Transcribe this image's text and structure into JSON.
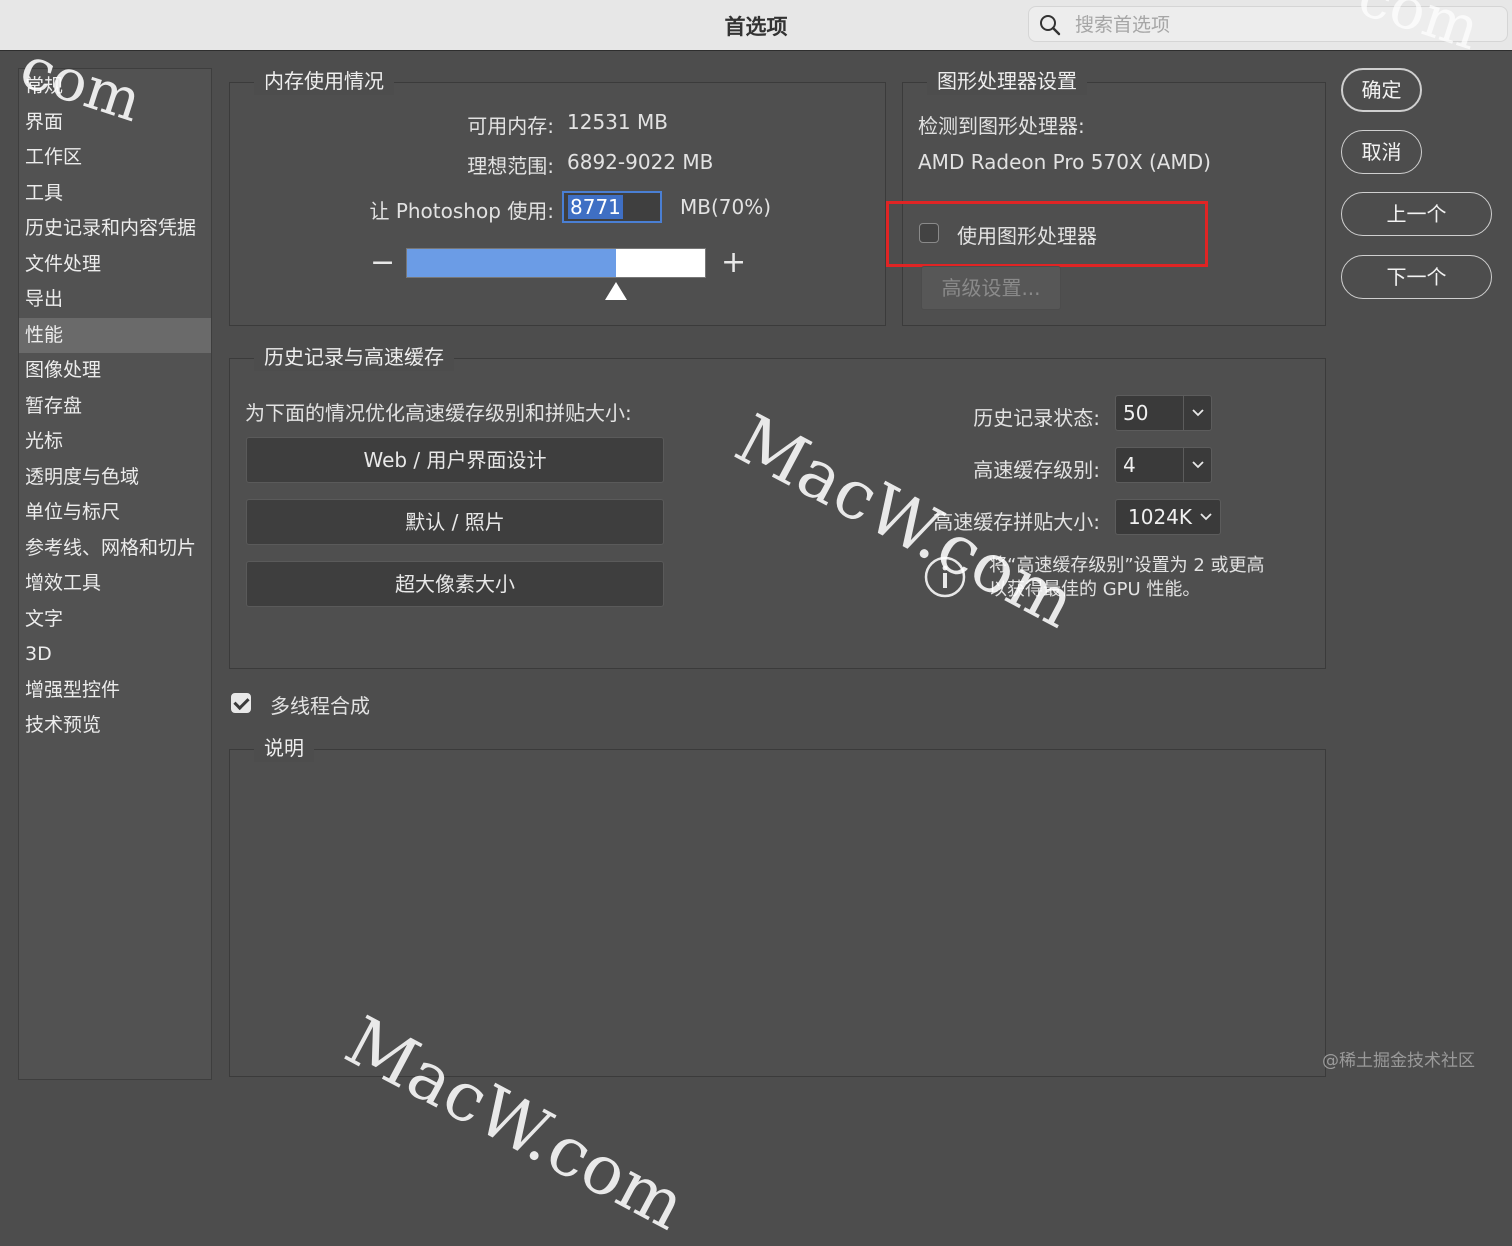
{
  "window": {
    "title": "首选项",
    "search_placeholder": "搜索首选项"
  },
  "sidebar": {
    "items": [
      {
        "label": "常规"
      },
      {
        "label": "界面"
      },
      {
        "label": "工作区"
      },
      {
        "label": "工具"
      },
      {
        "label": "历史记录和内容凭据"
      },
      {
        "label": "文件处理"
      },
      {
        "label": "导出"
      },
      {
        "label": "性能",
        "active": true
      },
      {
        "label": "图像处理"
      },
      {
        "label": "暂存盘"
      },
      {
        "label": "光标"
      },
      {
        "label": "透明度与色域"
      },
      {
        "label": "单位与标尺"
      },
      {
        "label": "参考线、网格和切片"
      },
      {
        "label": "增效工具"
      },
      {
        "label": "文字"
      },
      {
        "label": "3D"
      },
      {
        "label": "增强型控件"
      },
      {
        "label": "技术预览"
      }
    ]
  },
  "memory": {
    "title": "内存使用情况",
    "available_label": "可用内存:",
    "available_value": "12531 MB",
    "ideal_label": "理想范围:",
    "ideal_value": "6892-9022 MB",
    "use_label": "让 Photoshop 使用:",
    "use_value": "8771",
    "use_unit": "MB(70%)",
    "slider_fraction": 0.7,
    "minus": "−",
    "plus": "+"
  },
  "gpu": {
    "title": "图形处理器设置",
    "detected_label": "检测到图形处理器:",
    "detected_value": "AMD Radeon Pro 570X (AMD)",
    "use_gpu_label": "使用图形处理器",
    "use_gpu_checked": false,
    "advanced_label": "高级设置..."
  },
  "history_cache": {
    "title": "历史记录与高速缓存",
    "optimize_label": "为下面的情况优化高速缓存级别和拼贴大小:",
    "presets": [
      "Web / 用户界面设计",
      "默认 / 照片",
      "超大像素大小"
    ],
    "history_states_label": "历史记录状态:",
    "history_states_value": "50",
    "cache_levels_label": "高速缓存级别:",
    "cache_levels_value": "4",
    "tile_size_label": "高速缓存拼贴大小:",
    "tile_size_value": "1024K",
    "tip_line1": "将“高速缓存级别”设置为 2 或更高",
    "tip_line2": "以获得最佳的 GPU 性能。"
  },
  "multithread": {
    "label": "多线程合成",
    "checked": true
  },
  "description": {
    "title": "说明"
  },
  "buttons": {
    "ok": "确定",
    "cancel": "取消",
    "prev": "上一个",
    "next": "下一个"
  },
  "overlays": {
    "watermark_main": "MacW.com",
    "watermark_corner": "com",
    "credit": "@稀土掘金技术社区"
  },
  "colors": {
    "slider_fill": "#6b9ce6",
    "highlight_border": "#e02424",
    "focus_border": "#4a7fd4"
  }
}
